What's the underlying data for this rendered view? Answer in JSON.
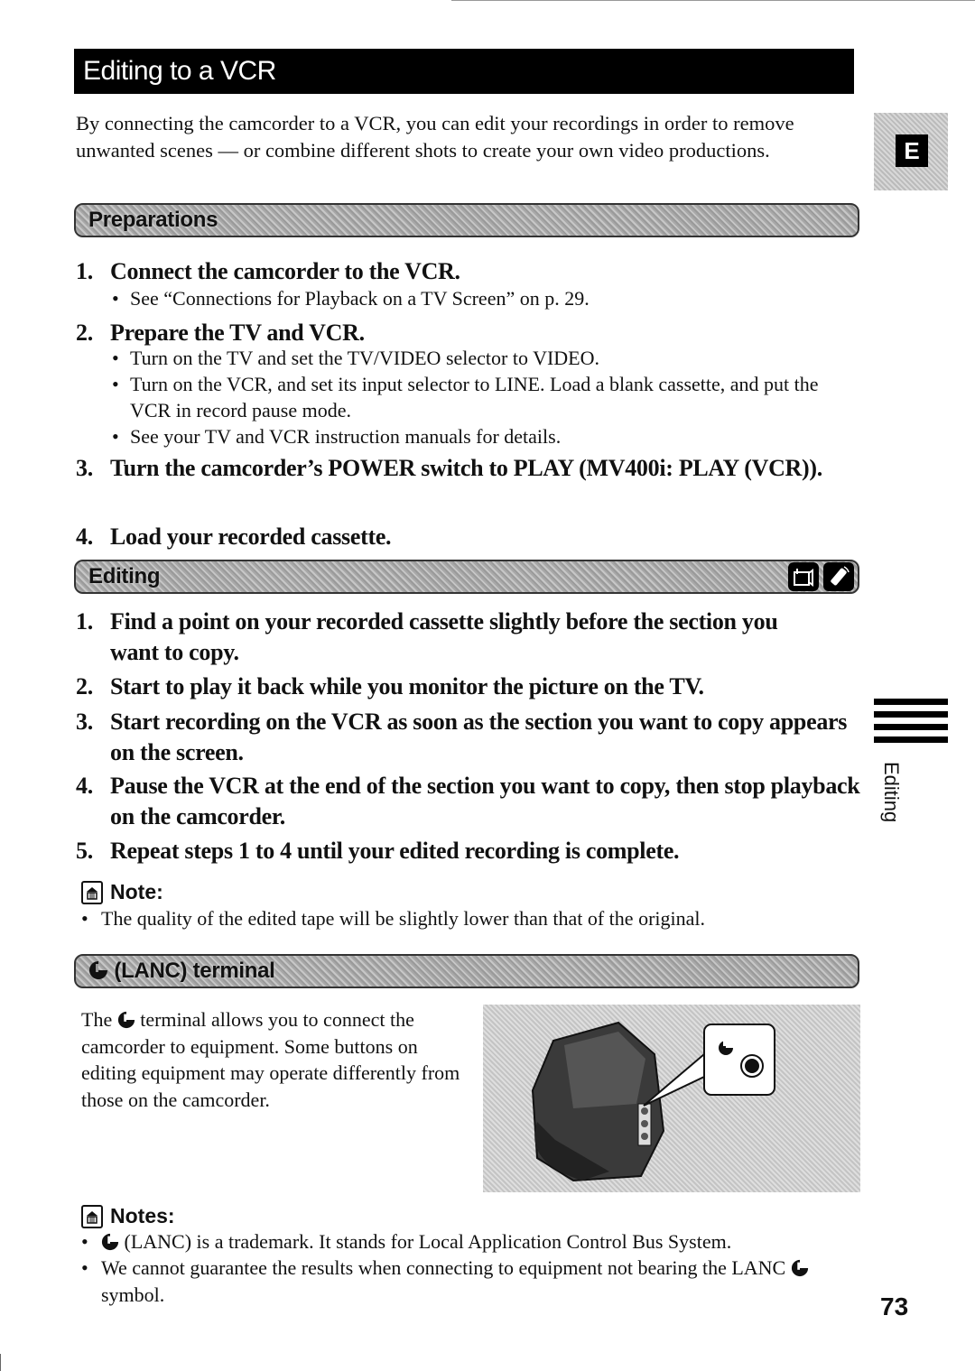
{
  "page": {
    "title": "Editing to a VCR",
    "intro": "By connecting the camcorder to a VCR, you can edit your recordings in order to remove unwanted scenes — or combine different shots to create your own video productions.",
    "language_tab": "E",
    "side_index_label": "Editing",
    "page_number": "73"
  },
  "preparations": {
    "heading": "Preparations",
    "steps": [
      {
        "num": "1.",
        "text": "Connect the camcorder to the VCR.",
        "bullets": [
          "See “Connections for Playback on a TV Screen” on p. 29."
        ]
      },
      {
        "num": "2.",
        "text": "Prepare the TV and VCR.",
        "bullets": [
          "Turn on the TV and set the TV/VIDEO selector to VIDEO.",
          "Turn on the VCR, and set its input selector to LINE. Load a blank cassette, and put the VCR in record pause mode.",
          "See your TV and VCR instruction manuals for details."
        ]
      },
      {
        "num": "3.",
        "text": "Turn the camcorder’s POWER switch to PLAY (MV400i: PLAY (VCR)).",
        "bullets": []
      },
      {
        "num": "4.",
        "text": "Load your recorded cassette.",
        "bullets": []
      }
    ]
  },
  "editing": {
    "heading": "Editing",
    "icons": [
      "camcorder-icon",
      "remote-control-icon"
    ],
    "steps": [
      {
        "num": "1.",
        "text": "Find a point on your recorded cassette slightly before the section you want to copy."
      },
      {
        "num": "2.",
        "text": "Start to play it back while you monitor the picture on the TV."
      },
      {
        "num": "3.",
        "text": "Start recording on the VCR as soon as the section you want to copy appears on the screen."
      },
      {
        "num": "4.",
        "text": "Pause the VCR at the end of the section you want to copy, then stop playback on the camcorder."
      },
      {
        "num": "5.",
        "text": "Repeat steps 1 to 4 until your edited recording is complete."
      }
    ],
    "note_heading": "Note:",
    "notes": [
      "The quality of the edited tape will be slightly lower than that of the original."
    ]
  },
  "lanc": {
    "heading": "(LANC) terminal",
    "para_pre": "The",
    "para_post": "terminal allows you to connect the camcorder to equipment. Some buttons on editing equipment may operate differently from those on the camcorder.",
    "notes_heading": "Notes:",
    "note1_post": "(LANC) is a trademark. It stands for Local Application Control Bus System.",
    "note2_pre": "We cannot guarantee the results when connecting to equipment not bearing the LANC",
    "note2_post": "symbol."
  }
}
